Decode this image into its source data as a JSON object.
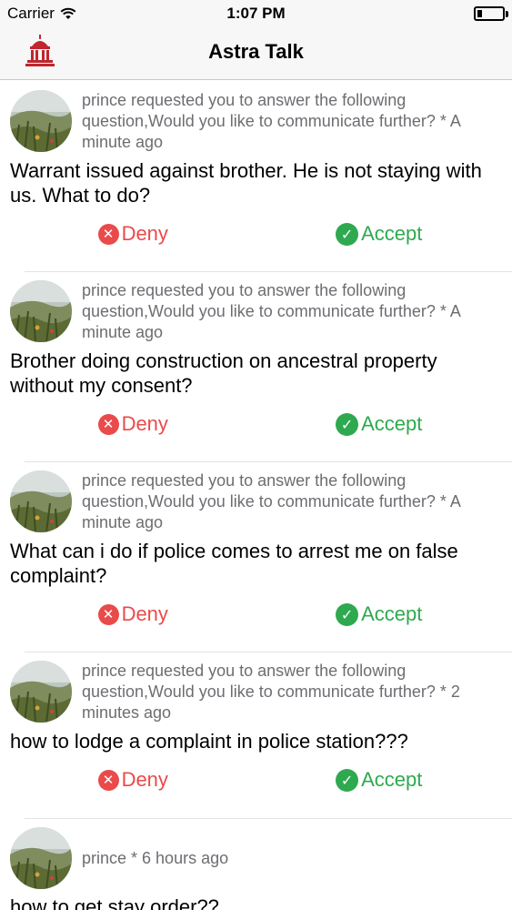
{
  "status": {
    "carrier": "Carrier",
    "time": "1:07 PM",
    "battery_level": 0.2
  },
  "nav": {
    "title": "Astra Talk",
    "logo_icon": "temple-icon"
  },
  "feed": [
    {
      "meta": "prince requested you to answer the following question,Would you like to communicate further? * A minute ago",
      "question": "Warrant issued against brother. He is not staying with us. What to do?",
      "deny_label": "Deny",
      "accept_label": "Accept"
    },
    {
      "meta": "prince requested you to answer the following question,Would you like to communicate further? * A minute ago",
      "question": "Brother doing construction on ancestral property without my consent?",
      "deny_label": "Deny",
      "accept_label": "Accept"
    },
    {
      "meta": "prince requested you to answer the following question,Would you like to communicate further? * A minute ago",
      "question": "What can i do if police comes to arrest me on false complaint?",
      "deny_label": "Deny",
      "accept_label": "Accept"
    },
    {
      "meta": "prince requested you to answer the following question,Would you like to communicate further? * 2 minutes ago",
      "question": "how to lodge a complaint in police station???",
      "deny_label": "Deny",
      "accept_label": "Accept"
    },
    {
      "meta": "prince * 6 hours ago",
      "question": "how to get stay order??"
    }
  ],
  "colors": {
    "deny": "#e94a4a",
    "accept": "#2fa94f",
    "meta": "#6d6d72",
    "logo": "#c0262d"
  }
}
